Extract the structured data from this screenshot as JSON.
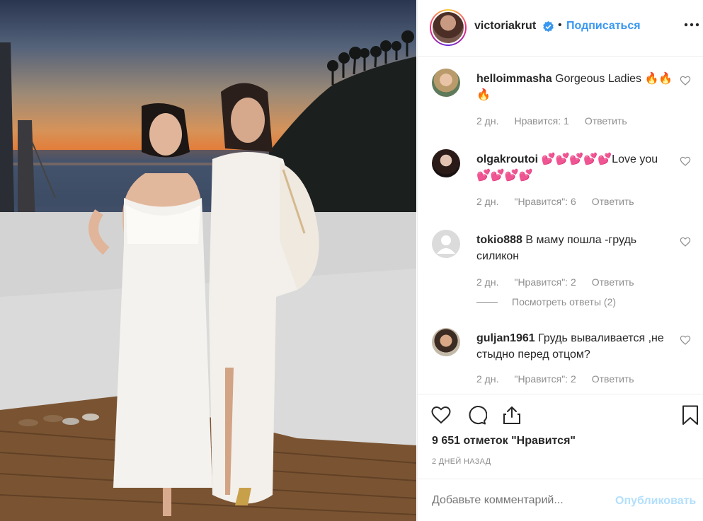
{
  "post": {
    "username": "victoriakrut",
    "verified": true,
    "separator": "•",
    "follow_label": "Подписаться",
    "likes_text": "9 651 отметок \"Нравится\"",
    "timestamp": "2 ДНЕЙ НАЗАД",
    "view_replies": "Посмотреть ответы (2)"
  },
  "comments": [
    {
      "username": "helloimmasha",
      "text": "Gorgeous Ladies 🔥🔥🔥",
      "time": "2 дн.",
      "likes": "Нравится: 1",
      "reply": "Ответить"
    },
    {
      "username": "olgakroutoi",
      "text": "💕💕💕💕💕Love you 💕💕💕💕",
      "time": "2 дн.",
      "likes": "\"Нравится\": 6",
      "reply": "Ответить"
    },
    {
      "username": "tokio888",
      "text": "В маму пошла -грудь силикон",
      "time": "2 дн.",
      "likes": "\"Нравится\": 2",
      "reply": "Ответить"
    },
    {
      "username": "guljan1961",
      "text": "Грудь вываливается ,не стыдно перед отцом?",
      "time": "2 дн.",
      "likes": "\"Нравится\": 2",
      "reply": "Ответить"
    }
  ],
  "add_comment": {
    "placeholder": "Добавьте комментарий...",
    "post_label": "Опубликовать"
  },
  "icons": {
    "verified": "verified-badge-icon",
    "more": "more-options-icon",
    "like": "heart-icon",
    "comment": "comment-icon",
    "share": "share-icon",
    "save": "bookmark-icon"
  },
  "colors": {
    "link": "#3897f0",
    "text": "#262626",
    "muted": "#8e8e8e",
    "post_disabled": "#b2dffc"
  }
}
